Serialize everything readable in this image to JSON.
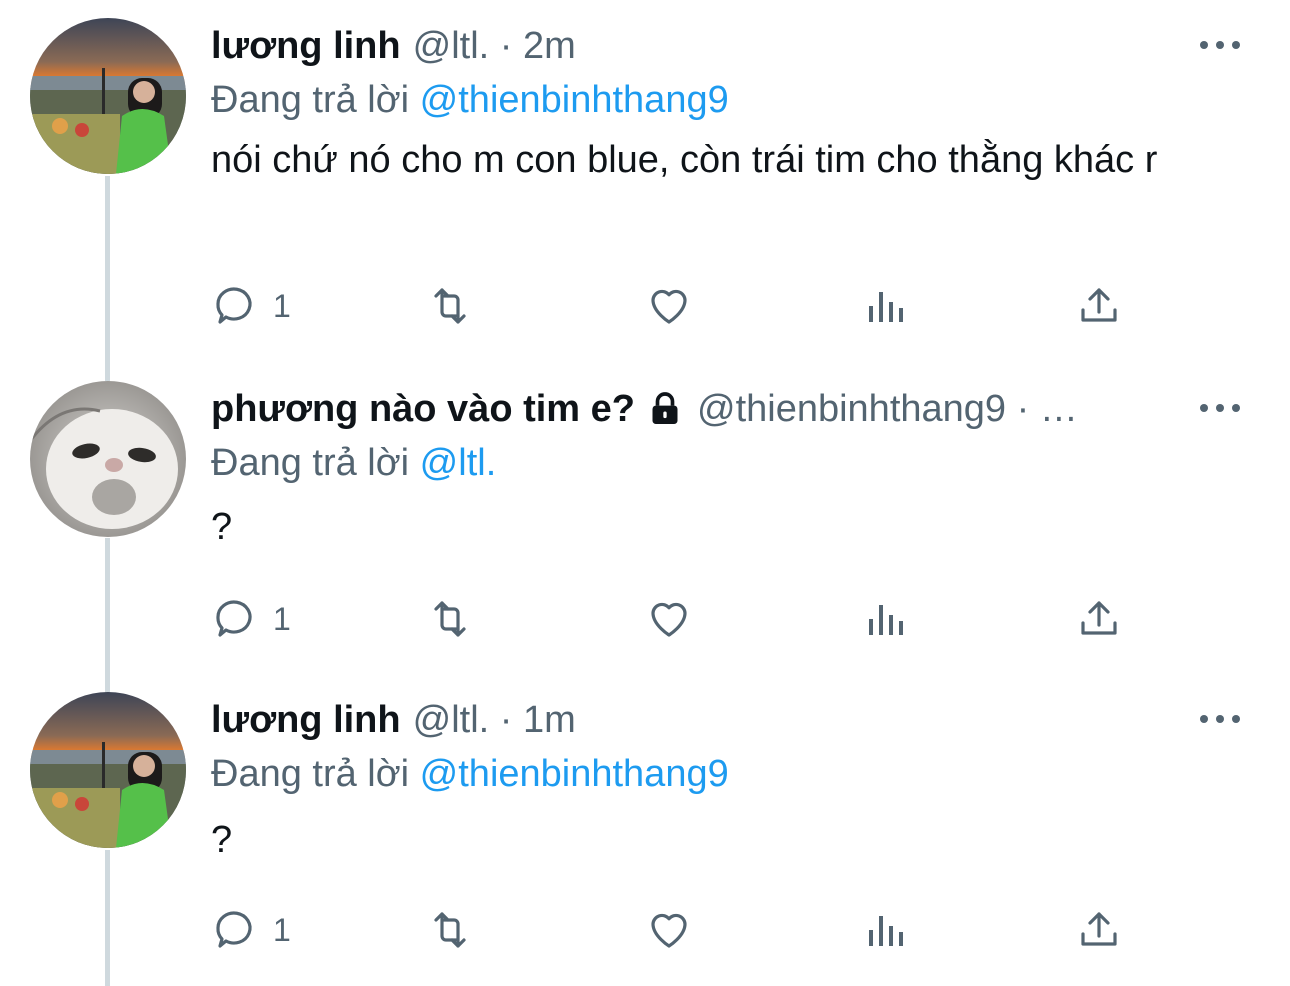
{
  "tweets": [
    {
      "name": "lương linh",
      "handle": "@ltl.",
      "time": "2m",
      "meta": "@ltl. · 2m",
      "replying_prefix": "Đang trả lời",
      "replying_to": "@thienbinhthang9",
      "text": "nói chứ nó cho m con blue, còn trái tim cho thằng khác r",
      "reply_count": "1",
      "avatar": "sunset-picnic-photo",
      "locked": false
    },
    {
      "name": "phương nào vào tim e?",
      "handle": "@thienbinhthang9",
      "time": "…",
      "meta": "@thienbinhthang9 · …",
      "replying_prefix": "Đang trả lời",
      "replying_to": "@ltl.",
      "text": "?",
      "reply_count": "1",
      "avatar": "cat-photo",
      "locked": true
    },
    {
      "name": "lương linh",
      "handle": "@ltl.",
      "time": "1m",
      "meta": "@ltl. · 1m",
      "replying_prefix": "Đang trả lời",
      "replying_to": "@thienbinhthang9",
      "text": "?",
      "reply_count": "1",
      "avatar": "sunset-picnic-photo",
      "locked": false
    }
  ],
  "icons": {
    "reply": "reply-icon",
    "retweet": "retweet-icon",
    "like": "like-icon",
    "views": "views-icon",
    "share": "share-icon",
    "more": "more-icon",
    "lock": "lock-icon"
  },
  "colors": {
    "text": "#0f1419",
    "secondary": "#536471",
    "link": "#1d9bf0",
    "thread_line": "#cfd9de"
  }
}
